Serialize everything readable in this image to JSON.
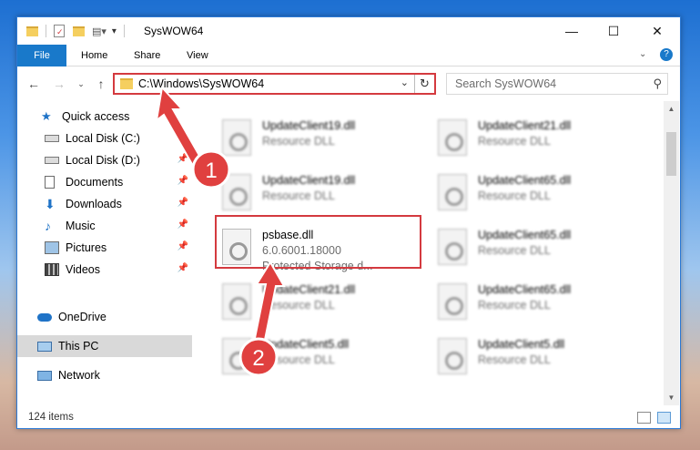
{
  "window": {
    "title": "SysWOW64"
  },
  "ribbon": {
    "tabs": [
      "File",
      "Home",
      "Share",
      "View"
    ]
  },
  "address": {
    "path": "C:\\Windows\\SysWOW64"
  },
  "search": {
    "placeholder": "Search SysWOW64"
  },
  "sidebar": {
    "quick_access": "Quick access",
    "items": [
      {
        "label": "Local Disk (C:)",
        "icon": "drive-icon",
        "pinned": true
      },
      {
        "label": "Local Disk (D:)",
        "icon": "drive-icon",
        "pinned": true
      },
      {
        "label": "Documents",
        "icon": "documents-icon",
        "pinned": true
      },
      {
        "label": "Downloads",
        "icon": "downloads-icon",
        "pinned": true
      },
      {
        "label": "Music",
        "icon": "music-icon",
        "pinned": true
      },
      {
        "label": "Pictures",
        "icon": "pictures-icon",
        "pinned": true
      },
      {
        "label": "Videos",
        "icon": "videos-icon",
        "pinned": true
      }
    ],
    "onedrive": "OneDrive",
    "this_pc": "This PC",
    "network": "Network"
  },
  "files": [
    {
      "name": "UpdateClient19.dll",
      "type": "Resource DLL"
    },
    {
      "name": "UpdateClient21.dll",
      "type": "Resource DLL"
    },
    {
      "name": "UpdateClient19.dll",
      "type": "Resource DLL"
    },
    {
      "name": "UpdateClient65.dll",
      "type": "Resource DLL"
    },
    {
      "name": "psbase.dll",
      "version": "6.0.6001.18000",
      "type": "Protected Storage d..."
    },
    {
      "name": "UpdateClient65.dll",
      "type": "Resource DLL"
    },
    {
      "name": "UpdateClient21.dll",
      "type": "Resource DLL"
    },
    {
      "name": "UpdateClient65.dll",
      "type": "Resource DLL"
    },
    {
      "name": "UpdateClient5.dll",
      "type": "Resource DLL"
    },
    {
      "name": "UpdateClient5.dll",
      "type": "Resource DLL"
    }
  ],
  "status": {
    "item_count": "124 items"
  },
  "annotations": {
    "step1": "1",
    "step2": "2"
  },
  "colors": {
    "highlight": "#d43a3f",
    "file_tab": "#1979ca",
    "arrow": "#e0403f"
  }
}
